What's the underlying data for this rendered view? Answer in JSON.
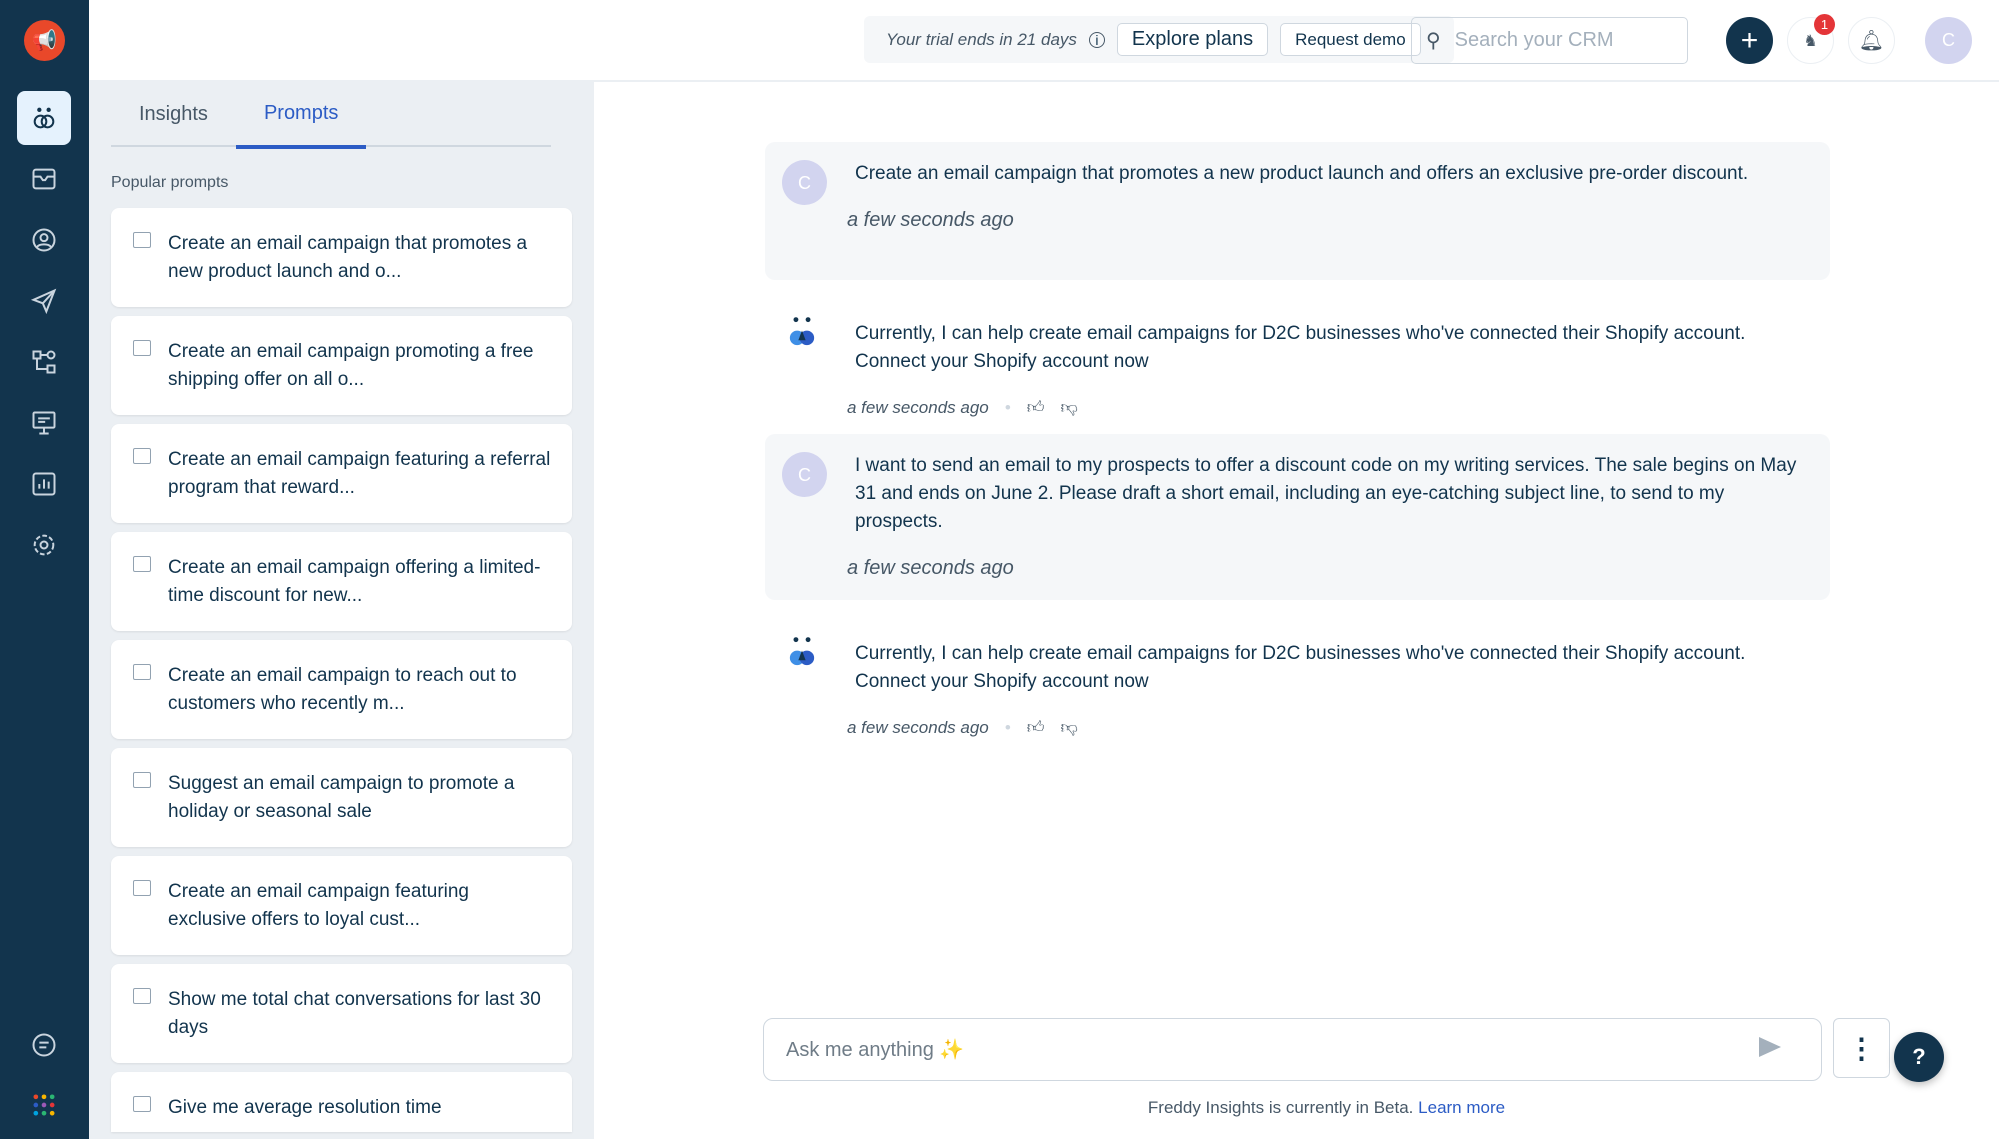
{
  "header": {
    "trial_text": "Your trial ends in 21 days",
    "explore_plans": "Explore plans",
    "request_demo": "Request demo",
    "search_placeholder": "Search your CRM",
    "notification_count": "1",
    "avatar_initial": "C"
  },
  "panel": {
    "tabs": [
      "Insights",
      "Prompts"
    ],
    "active_tab": "Prompts",
    "section_title": "Popular prompts",
    "prompts": [
      "Create an email campaign that promotes a new product launch and o...",
      "Create an email campaign promoting a free shipping offer on all o...",
      "Create an email campaign featuring a referral program that reward...",
      "Create an email campaign offering a limited-time discount for new...",
      "Create an email campaign to reach out to customers who recently m...",
      "Suggest an email campaign to promote a holiday or seasonal sale",
      "Create an email campaign featuring exclusive offers to loyal cust...",
      "Show me total chat conversations for last 30 days",
      "Give me average resolution time"
    ]
  },
  "chat": {
    "messages": [
      {
        "role": "user",
        "avatar": "C",
        "text": "Create an email campaign that promotes a new product launch and offers an exclusive pre-order discount.",
        "time": "a few seconds ago"
      },
      {
        "role": "bot",
        "text": "Currently, I can help create email campaigns for D2C businesses who've connected their Shopify account. Connect your Shopify account now",
        "time": "a few seconds ago"
      },
      {
        "role": "user",
        "avatar": "C",
        "text": "I want to send an email to my prospects to offer a discount code on my writing services. The sale begins on May 31 and ends on June 2. Please draft a short email, including an eye-catching subject line, to send to my prospects.",
        "time": "a few seconds ago"
      },
      {
        "role": "bot",
        "text": "Currently, I can help create email campaigns for D2C businesses who've connected their Shopify account. Connect your Shopify account now",
        "time": "a few seconds ago"
      }
    ],
    "input_placeholder": "Ask me anything ✨",
    "beta_text": "Freddy Insights is currently in Beta.",
    "learn_more": "Learn more",
    "help": "?"
  }
}
